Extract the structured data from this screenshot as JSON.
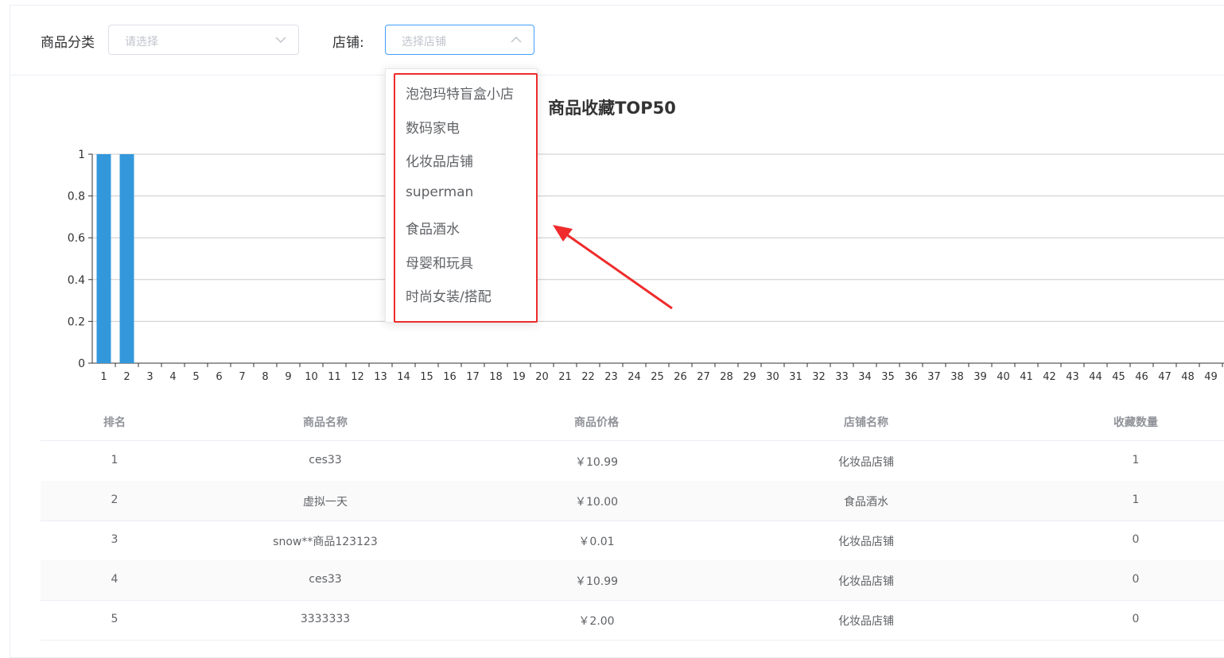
{
  "filters": {
    "category_label": "商品分类",
    "category_placeholder": "请选择",
    "store_label": "店铺:",
    "store_placeholder": "选择店铺"
  },
  "store_dropdown": {
    "options": [
      "泡泡玛特盲盒小店",
      "数码家电",
      "化妆品店铺",
      "superman",
      "食品酒水",
      "母婴和玩具",
      "时尚女装/搭配"
    ]
  },
  "chart_data": {
    "type": "bar",
    "title": "商品收藏TOP50",
    "categories": [
      "1",
      "2",
      "3",
      "4",
      "5",
      "6",
      "7",
      "8",
      "9",
      "10",
      "11",
      "12",
      "13",
      "14",
      "15",
      "16",
      "17",
      "18",
      "19",
      "20",
      "21",
      "22",
      "23",
      "24",
      "25",
      "26",
      "27",
      "28",
      "29",
      "30",
      "31",
      "32",
      "33",
      "34",
      "35",
      "36",
      "37",
      "38",
      "39",
      "40",
      "41",
      "42",
      "43",
      "44",
      "45",
      "46",
      "47",
      "48",
      "49"
    ],
    "values": [
      1,
      1,
      0,
      0,
      0,
      0,
      0,
      0,
      0,
      0,
      0,
      0,
      0,
      0,
      0,
      0,
      0,
      0,
      0,
      0,
      0,
      0,
      0,
      0,
      0,
      0,
      0,
      0,
      0,
      0,
      0,
      0,
      0,
      0,
      0,
      0,
      0,
      0,
      0,
      0,
      0,
      0,
      0,
      0,
      0,
      0,
      0,
      0,
      0
    ],
    "yticks": [
      "0",
      "0.2",
      "0.4",
      "0.6",
      "0.8",
      "1"
    ],
    "ylim": [
      0,
      1
    ],
    "grid": true,
    "bar_color": "#3398db"
  },
  "table": {
    "headers": [
      "排名",
      "商品名称",
      "商品价格",
      "店铺名称",
      "收藏数量"
    ],
    "rows": [
      [
        "1",
        "ces33",
        "￥10.99",
        "化妆品店铺",
        "1"
      ],
      [
        "2",
        "虚拟一天",
        "￥10.00",
        "食品酒水",
        "1"
      ],
      [
        "3",
        "snow**商品123123",
        "￥0.01",
        "化妆品店铺",
        "0"
      ],
      [
        "4",
        "ces33",
        "￥10.99",
        "化妆品店铺",
        "0"
      ],
      [
        "5",
        "3333333",
        "￥2.00",
        "化妆品店铺",
        "0"
      ]
    ]
  },
  "colors": {
    "annotation_red": "#ef2b2b",
    "select_active_border": "#409eff"
  }
}
